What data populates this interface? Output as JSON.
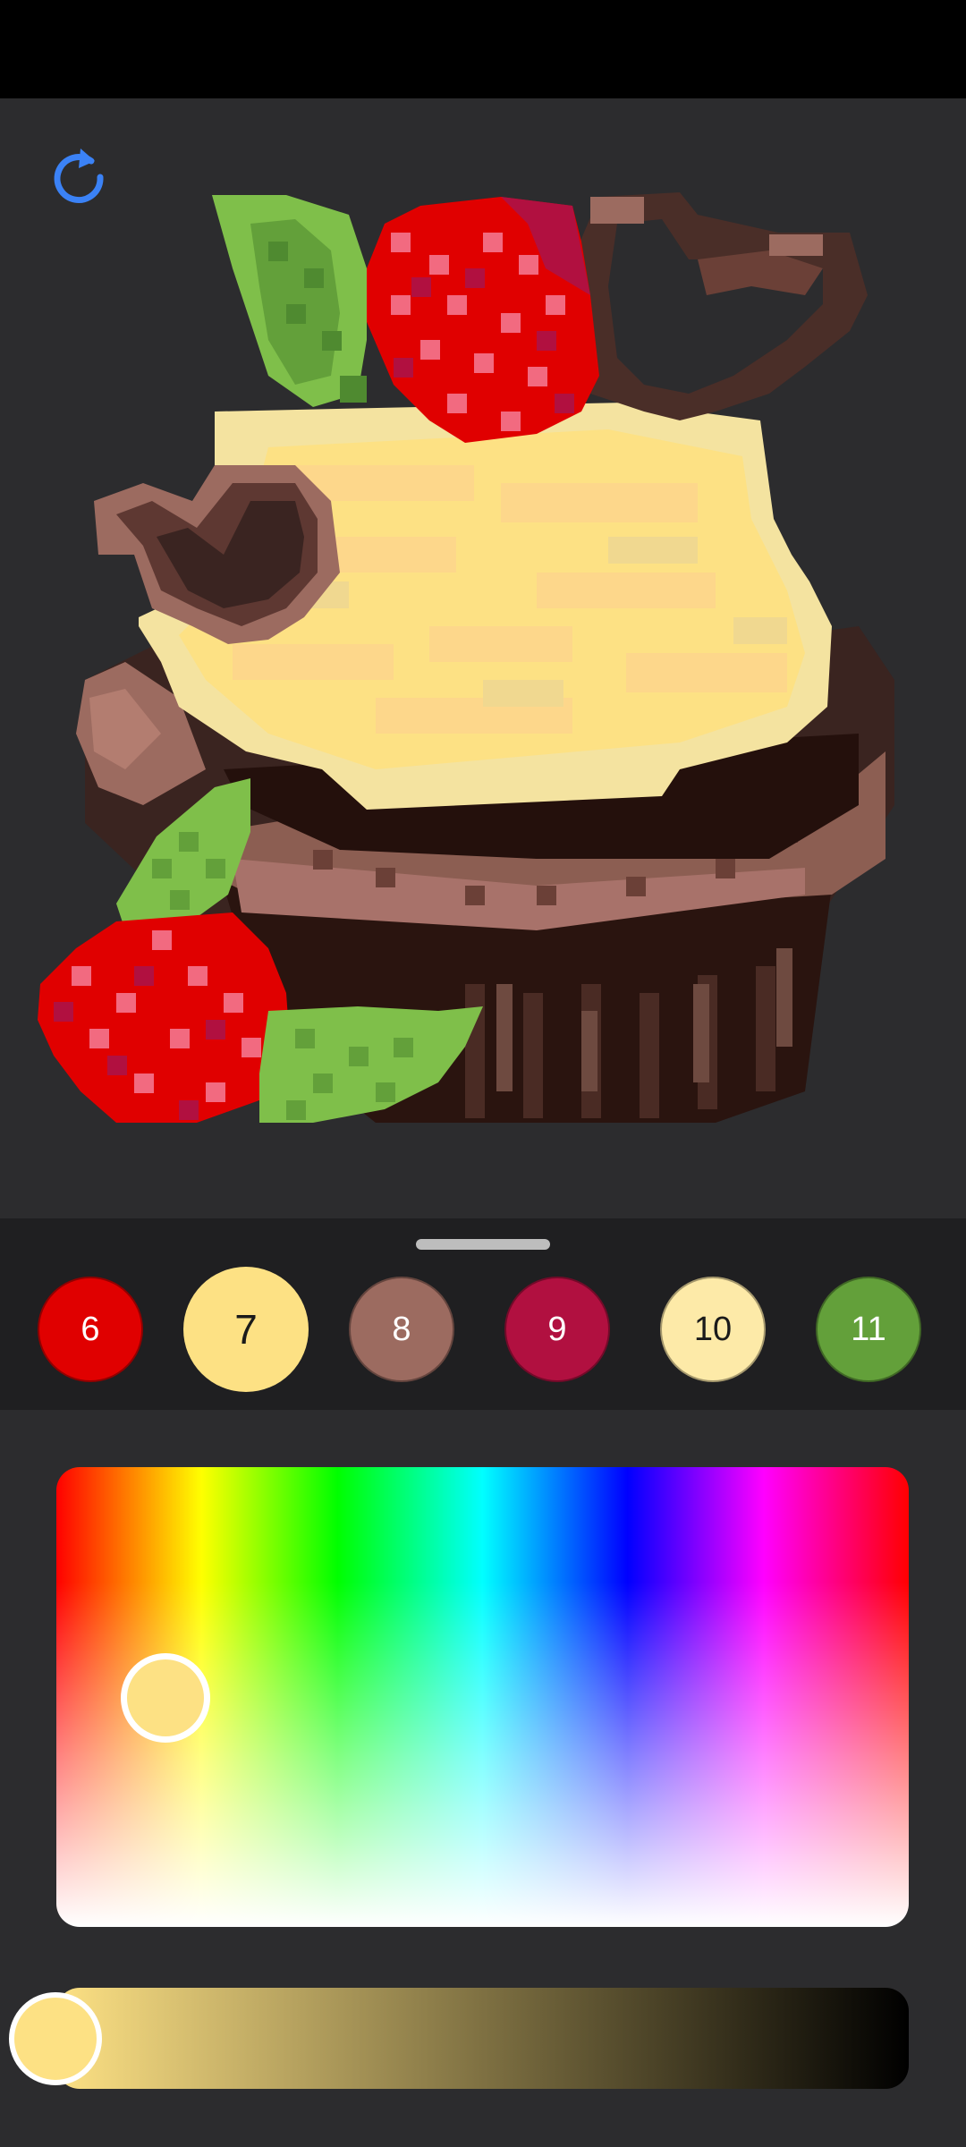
{
  "screen": {
    "background": "#2c2c2e",
    "status_bar_color": "#000000",
    "palette_bg": "#1f1f21"
  },
  "toolbar": {
    "refresh_icon": "refresh-icon",
    "accent": "#3b82f6"
  },
  "palette": {
    "selected_index": 1,
    "swatches": [
      {
        "number": "6",
        "color": "#e00000",
        "text_color": "#ffffff"
      },
      {
        "number": "7",
        "color": "#fde184",
        "text_color": "#1a1a1a"
      },
      {
        "number": "8",
        "color": "#9c6b60",
        "text_color": "#ffffff"
      },
      {
        "number": "9",
        "color": "#b11040",
        "text_color": "#ffffff"
      },
      {
        "number": "10",
        "color": "#fdeaa8",
        "text_color": "#1a1a1a"
      },
      {
        "number": "11",
        "color": "#63a03a",
        "text_color": "#ffffff"
      }
    ]
  },
  "color_picker": {
    "current_color": "#fde184",
    "hue_position": 0.14,
    "saturation_position": 0.5,
    "brightness": 1.0
  }
}
